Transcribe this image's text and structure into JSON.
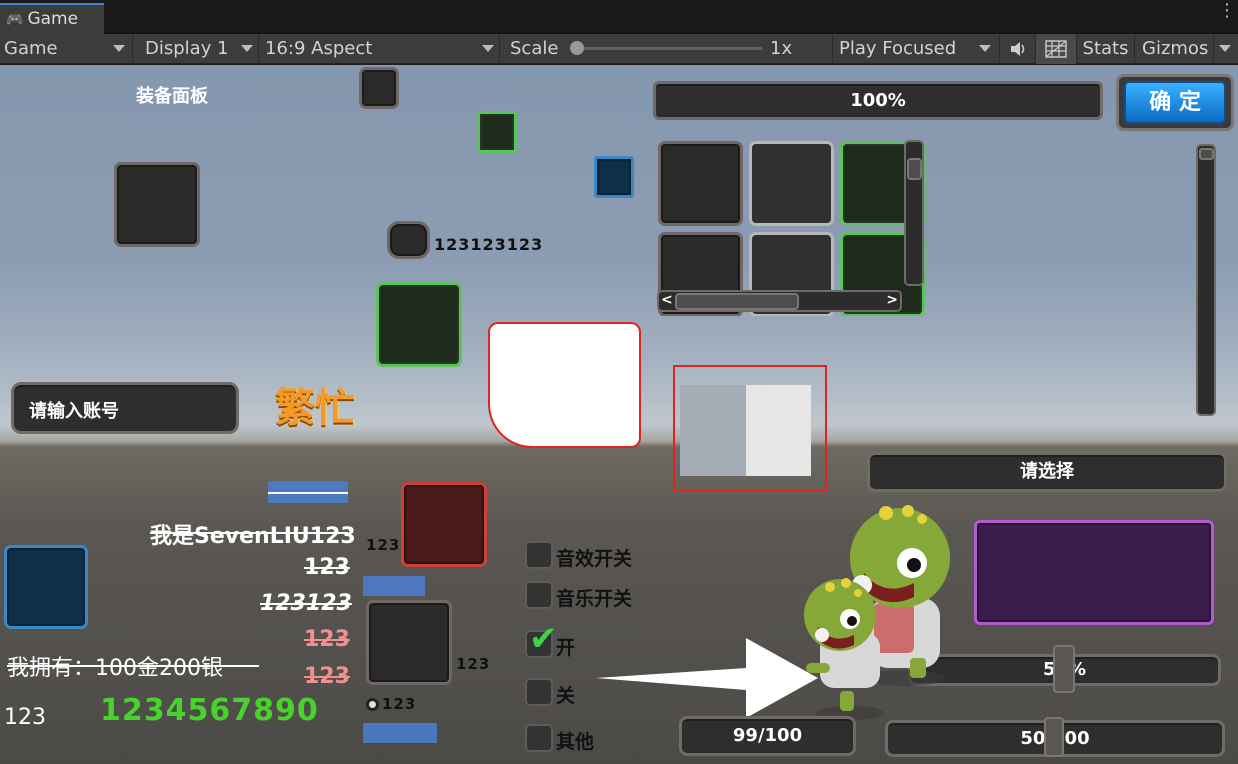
{
  "window": {
    "tab_title": "Game",
    "tab_icon": "gamepad-icon"
  },
  "toolbar": {
    "view_mode": "Game",
    "display": "Display 1",
    "aspect": "16:9 Aspect",
    "scale_label": "Scale",
    "scale_value": "1x",
    "play_mode": "Play Focused",
    "stats_label": "Stats",
    "gizmos_label": "Gizmos"
  },
  "scene": {
    "equip_panel_title": "装备面板",
    "slot_number_label": "123123123",
    "top_progress_text": "100%",
    "top_progress_value": 1.0,
    "confirm_button": "确 定",
    "account_input_placeholder": "请输入账号",
    "busy_label": "繁忙",
    "dropdown_label": "请选择",
    "rich_text": {
      "line1": "我是SevenLIU123",
      "line2": "123",
      "line3": "123123",
      "line4": "123",
      "line5": "123"
    },
    "slot_count_left": "123",
    "slot_count_right": "123",
    "radio_label": "123",
    "money_text": "我拥有：100金200银",
    "plain_number": "123",
    "green_number": "1234567890",
    "toggles": [
      {
        "label": "音效开关",
        "checked": false
      },
      {
        "label": "音乐开关",
        "checked": false
      },
      {
        "label": "开",
        "checked": true
      },
      {
        "label": "关",
        "checked": false
      },
      {
        "label": "其他",
        "checked": false
      }
    ],
    "slider_top_text": "50%",
    "slider_top_value": 0.5,
    "hp_text": "99/100",
    "hp_value": 0.99,
    "mp_text": "50/100",
    "mp_value": 0.5
  },
  "colors": {
    "accent_blue": "#4a7fd0",
    "slot_green": "#5ec160",
    "confirm_blue": "#1a7fd8",
    "busy_orange": "#f39b26",
    "number_green": "#47d22c"
  }
}
